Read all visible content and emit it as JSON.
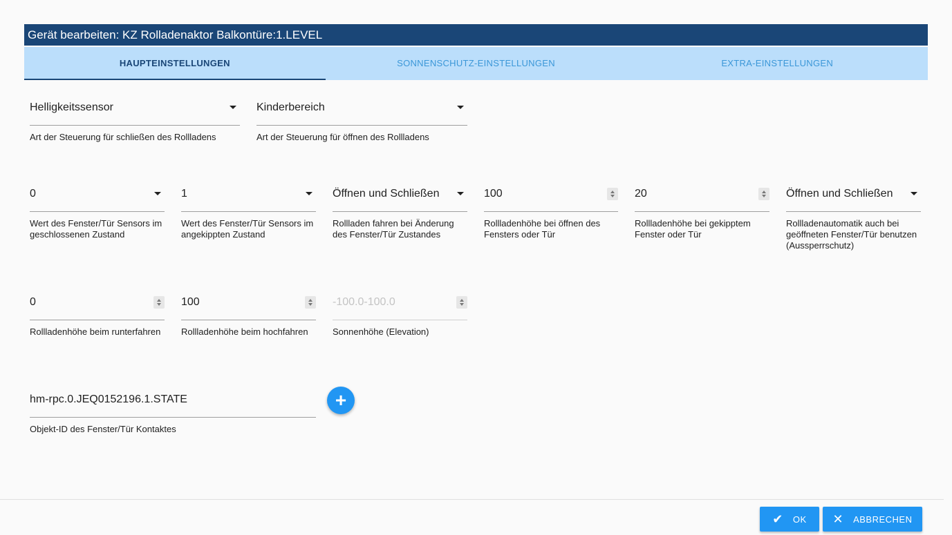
{
  "dialog": {
    "title": "Gerät bearbeiten: KZ Rolladenaktor Balkontüre:1.LEVEL"
  },
  "tabs": [
    {
      "label": "HAUPTEINSTELLUNGEN",
      "active": true
    },
    {
      "label": "SONNENSCHUTZ-EINSTELLUNGEN",
      "active": false
    },
    {
      "label": "EXTRA-EINSTELLUNGEN",
      "active": false
    }
  ],
  "fields": {
    "close_control": {
      "value": "Helligkeitssensor",
      "label": "Art der Steuerung für schließen des Rollladens"
    },
    "open_control": {
      "value": "Kinderbereich",
      "label": "Art der Steuerung für öffnen des Rollladens"
    },
    "sensor_closed": {
      "value": "0",
      "label": "Wert des Fenster/Tür Sensors im geschlossenen Zustand"
    },
    "sensor_tilted": {
      "value": "1",
      "label": "Wert des Fenster/Tür Sensors im angekippten Zustand"
    },
    "move_on_change": {
      "value": "Öffnen und Schließen",
      "label": "Rollladen fahren bei Änderung des Fenster/Tür Zustandes"
    },
    "height_open_window": {
      "value": "100",
      "label": "Rollladenhöhe bei öffnen des Fensters oder Tür"
    },
    "height_tilted_window": {
      "value": "20",
      "label": "Rollladenhöhe bei gekipptem Fenster oder Tür"
    },
    "lockout_protection": {
      "value": "Öffnen und Schließen",
      "label": "Rollladenautomatik auch bei geöffneten Fenster/Tür benutzen (Aussperrschutz)"
    },
    "height_down": {
      "value": "0",
      "label": "Rollladenhöhe beim runterfahren"
    },
    "height_up": {
      "value": "100",
      "label": "Rollladenhöhe beim hochfahren"
    },
    "sun_elevation": {
      "placeholder": "-100.0-100.0",
      "label": "Sonnenhöhe (Elevation)"
    },
    "object_id": {
      "value": "hm-rpc.0.JEQ0152196.1.STATE",
      "label": "Objekt-ID des Fenster/Tür Kontaktes"
    }
  },
  "buttons": {
    "ok": "OK",
    "cancel": "ABBRECHEN"
  },
  "colors": {
    "header": "#1a4677",
    "tab_bar": "#bbdefb",
    "accent": "#2196f3"
  },
  "icons": {
    "add": "plus-icon",
    "ok": "check-icon",
    "cancel": "close-icon"
  }
}
